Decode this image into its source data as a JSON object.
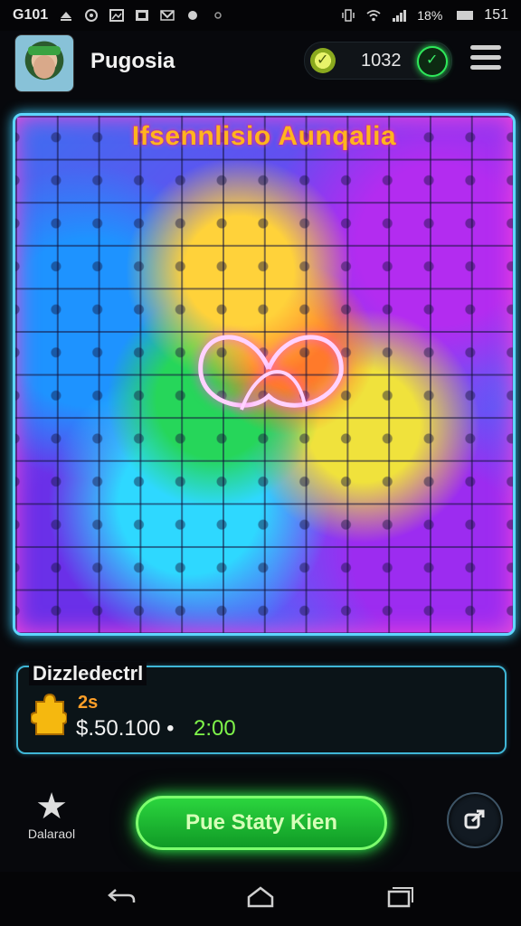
{
  "status_bar": {
    "time_left": "G101",
    "battery": "18%",
    "time_right": "151"
  },
  "header": {
    "title": "Pugosia",
    "coins": "1032"
  },
  "board": {
    "title": "Ifsennlisio Aunqalia"
  },
  "info_card": {
    "title": "Dizzledectrl",
    "count": "2s",
    "price": "$.50.100",
    "separator": "•",
    "time": "2:00"
  },
  "actions": {
    "favorite_label": "Dalaraol",
    "play_label": "Pue Staty Kien"
  },
  "colors": {
    "accent_green": "#2ee84a",
    "board_border": "#5fd6ff",
    "title_orange": "#ffb51e"
  }
}
